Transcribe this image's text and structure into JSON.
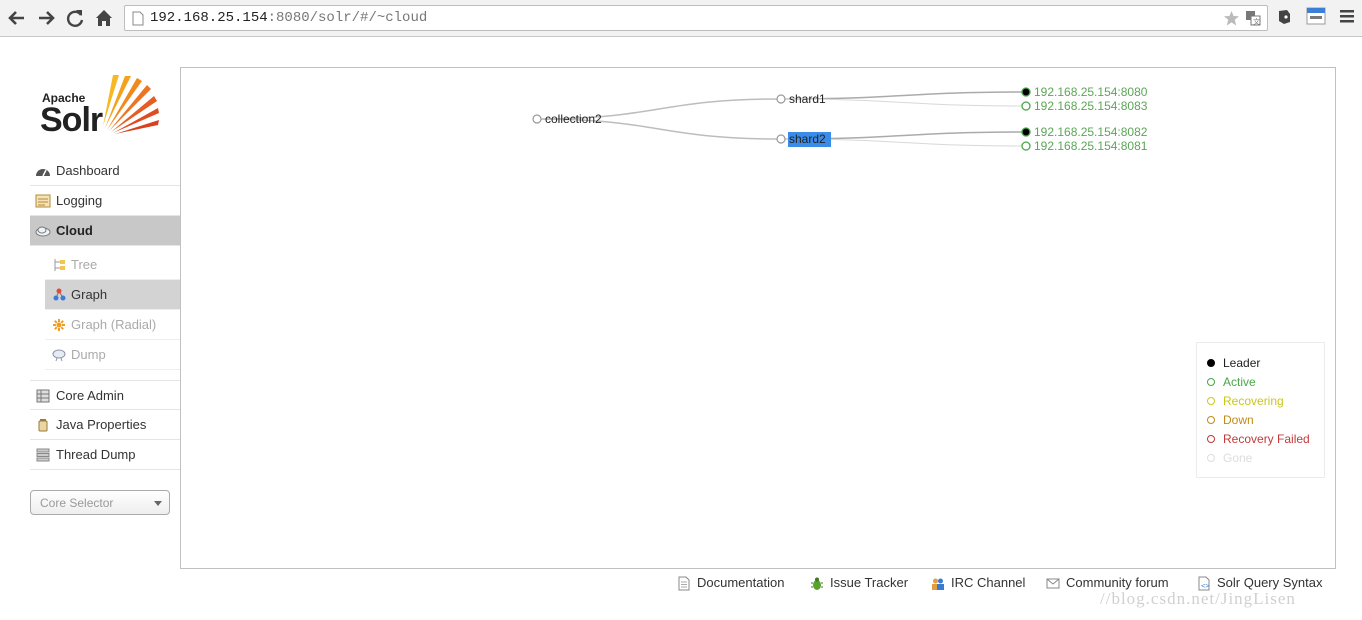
{
  "browser": {
    "url_host": "192.168.25.154",
    "url_rest": ":8080/solr/#/~cloud"
  },
  "logo": {
    "apache": "Apache",
    "solr": "Solr"
  },
  "nav": {
    "dashboard": "Dashboard",
    "logging": "Logging",
    "cloud": "Cloud",
    "tree": "Tree",
    "graph": "Graph",
    "graph_radial": "Graph (Radial)",
    "dump": "Dump",
    "core_admin": "Core Admin",
    "java_properties": "Java Properties",
    "thread_dump": "Thread Dump"
  },
  "core_selector": {
    "placeholder": "Core Selector"
  },
  "graph": {
    "collection": "collection2",
    "shards": [
      {
        "name": "shard1",
        "selected": false,
        "replicas": [
          {
            "host": "192.168.25.154:8080",
            "state": "leader"
          },
          {
            "host": "192.168.25.154:8083",
            "state": "active"
          }
        ]
      },
      {
        "name": "shard2",
        "selected": true,
        "replicas": [
          {
            "host": "192.168.25.154:8082",
            "state": "leader"
          },
          {
            "host": "192.168.25.154:8081",
            "state": "active"
          }
        ]
      }
    ]
  },
  "legend": [
    {
      "label": "Leader",
      "color": "#000000",
      "filled": true
    },
    {
      "label": "Active",
      "color": "#4aa54a",
      "filled": false
    },
    {
      "label": "Recovering",
      "color": "#c9c71d",
      "filled": false
    },
    {
      "label": "Down",
      "color": "#c08b1a",
      "filled": false
    },
    {
      "label": "Recovery Failed",
      "color": "#c33a3a",
      "filled": false
    },
    {
      "label": "Gone",
      "color": "#dddddd",
      "filled": false
    }
  ],
  "footer": {
    "documentation": "Documentation",
    "issue_tracker": "Issue Tracker",
    "irc_channel": "IRC Channel",
    "community_forum": "Community forum",
    "query_syntax": "Solr Query Syntax"
  },
  "watermark": "//blog.csdn.net/JingLisen"
}
